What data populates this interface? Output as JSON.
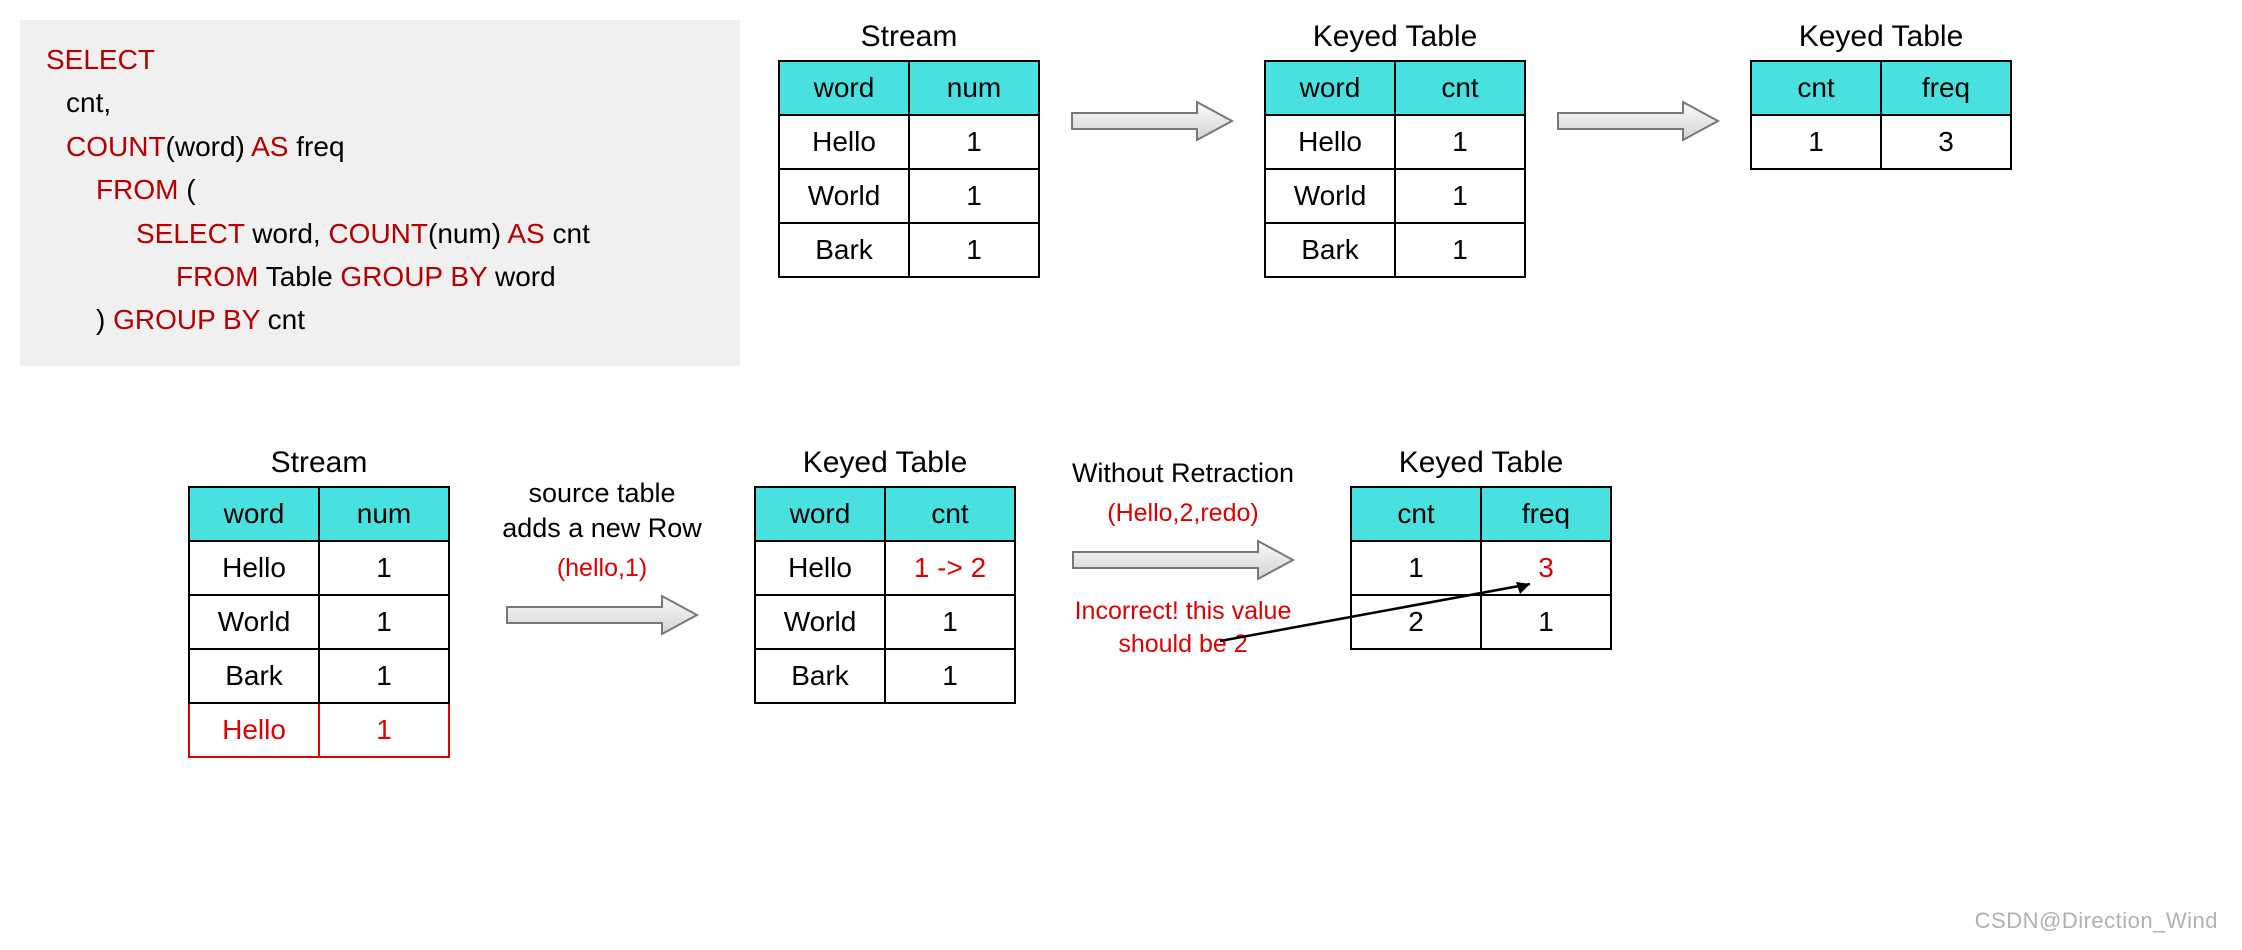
{
  "sql": {
    "l1_kw": "SELECT",
    "l2_tx": "cnt,",
    "l3_kw1": "COUNT",
    "l3_tx1": "(word)",
    "l3_kw2": " AS",
    "l3_tx2": " freq",
    "l4_kw": "FROM",
    "l4_tx": "  (",
    "l5_kw1": "SELECT",
    "l5_tx1": " word,  ",
    "l5_kw2": "COUNT",
    "l5_tx2": "(num)",
    "l5_kw3": " AS",
    "l5_tx3": " cnt",
    "l6_kw1": "FROM",
    "l6_tx1": " Table",
    "l6_kw2": " GROUP BY",
    "l6_tx2": " word",
    "l7_tx": ")",
    "l7_kw": " GROUP BY",
    "l7_tx2": " cnt"
  },
  "titles": {
    "stream": "Stream",
    "keyed": "Keyed Table"
  },
  "headers": {
    "word": "word",
    "num": "num",
    "cnt": "cnt",
    "freq": "freq"
  },
  "top": {
    "stream": [
      {
        "c1": "Hello",
        "c2": "1"
      },
      {
        "c1": "World",
        "c2": "1"
      },
      {
        "c1": "Bark",
        "c2": "1"
      }
    ],
    "keyed1": [
      {
        "c1": "Hello",
        "c2": "1"
      },
      {
        "c1": "World",
        "c2": "1"
      },
      {
        "c1": "Bark",
        "c2": "1"
      }
    ],
    "keyed2": [
      {
        "c1": "1",
        "c2": "3"
      }
    ]
  },
  "bottom": {
    "stream": [
      {
        "c1": "Hello",
        "c2": "1",
        "red": false
      },
      {
        "c1": "World",
        "c2": "1",
        "red": false
      },
      {
        "c1": "Bark",
        "c2": "1",
        "red": false
      },
      {
        "c1": "Hello",
        "c2": "1",
        "red": true
      }
    ],
    "keyed1": [
      {
        "c1": "Hello",
        "c2": "1 -> 2",
        "c2red": true
      },
      {
        "c1": "World",
        "c2": "1",
        "c2red": false
      },
      {
        "c1": "Bark",
        "c2": "1",
        "c2red": false
      }
    ],
    "keyed2": [
      {
        "c1": "1",
        "c2": "3",
        "c2red": true
      },
      {
        "c1": "2",
        "c2": "1",
        "c2red": false
      }
    ]
  },
  "captions": {
    "arr2_top": "source table\nadds a new Row",
    "arr2_red": "(hello,1)",
    "arr3_top": "Without Retraction",
    "arr3_red1": "(Hello,2,redo)",
    "arr3_red2": "Incorrect! this value\nshould be 2"
  },
  "watermark": "CSDN@Direction_Wind"
}
